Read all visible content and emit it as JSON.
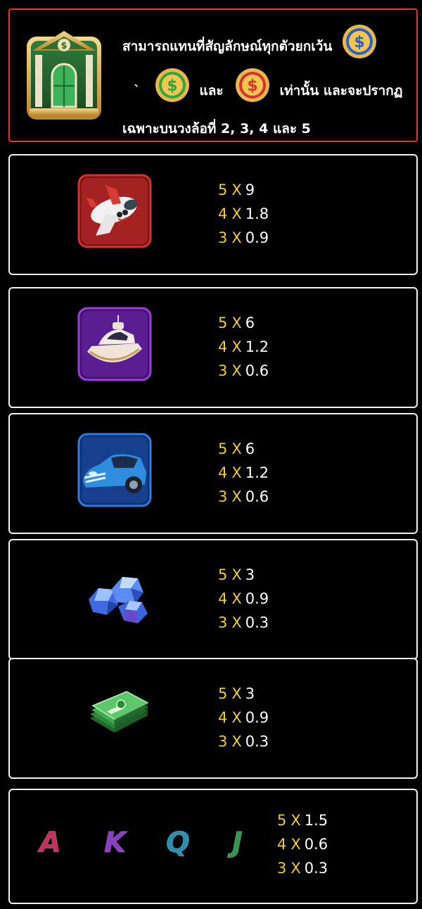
{
  "wild": {
    "icon": "bank-wild-icon",
    "line1": "สามารถแทนที่สัญลักษณ์ทุกตัวยกเว้น",
    "line2_prefix": "`",
    "line2_and": "และ",
    "line2_suffix": "เท่านั้น และจะปรากฏ",
    "line3": "เฉพาะบนวงล้อที่ 2, 3, 4 และ 5",
    "coin_colors": {
      "blue": "#2a5fcf",
      "green": "#2fa640",
      "red": "#d5332c"
    }
  },
  "paytable": [
    {
      "symbol": "airplane-icon",
      "border": "#d9302c",
      "pays": [
        {
          "count": "5",
          "x": "X",
          "value": "9"
        },
        {
          "count": "4",
          "x": "X",
          "value": "1.8"
        },
        {
          "count": "3",
          "x": "X",
          "value": "0.9"
        }
      ]
    },
    {
      "symbol": "yacht-icon",
      "border": "#a13be0",
      "pays": [
        {
          "count": "5",
          "x": "X",
          "value": "6"
        },
        {
          "count": "4",
          "x": "X",
          "value": "1.2"
        },
        {
          "count": "3",
          "x": "X",
          "value": "0.6"
        }
      ]
    },
    {
      "symbol": "sports-car-icon",
      "border": "#2f7be8",
      "pays": [
        {
          "count": "5",
          "x": "X",
          "value": "6"
        },
        {
          "count": "4",
          "x": "X",
          "value": "1.2"
        },
        {
          "count": "3",
          "x": "X",
          "value": "0.6"
        }
      ]
    },
    {
      "symbol": "diamonds-icon",
      "pays": [
        {
          "count": "5",
          "x": "X",
          "value": "3"
        },
        {
          "count": "4",
          "x": "X",
          "value": "0.9"
        },
        {
          "count": "3",
          "x": "X",
          "value": "0.3"
        }
      ]
    },
    {
      "symbol": "cash-stack-icon",
      "pays": [
        {
          "count": "5",
          "x": "X",
          "value": "3"
        },
        {
          "count": "4",
          "x": "X",
          "value": "0.9"
        },
        {
          "count": "3",
          "x": "X",
          "value": "0.3"
        }
      ]
    }
  ],
  "letters": {
    "symbols": [
      {
        "char": "A",
        "color": "#c0305a"
      },
      {
        "char": "K",
        "color": "#8a3cc8"
      },
      {
        "char": "Q",
        "color": "#2a8fb0"
      },
      {
        "char": "J",
        "color": "#2e9a4e"
      }
    ],
    "pays": [
      {
        "count": "5",
        "x": "X",
        "value": "1.5"
      },
      {
        "count": "4",
        "x": "X",
        "value": "0.6"
      },
      {
        "count": "3",
        "x": "X",
        "value": "0.3"
      }
    ]
  },
  "colors": {
    "count": "#f2cc35",
    "value": "#ffffff",
    "panel_border": "#f2f2f2",
    "wild_border": "#d93b32"
  }
}
